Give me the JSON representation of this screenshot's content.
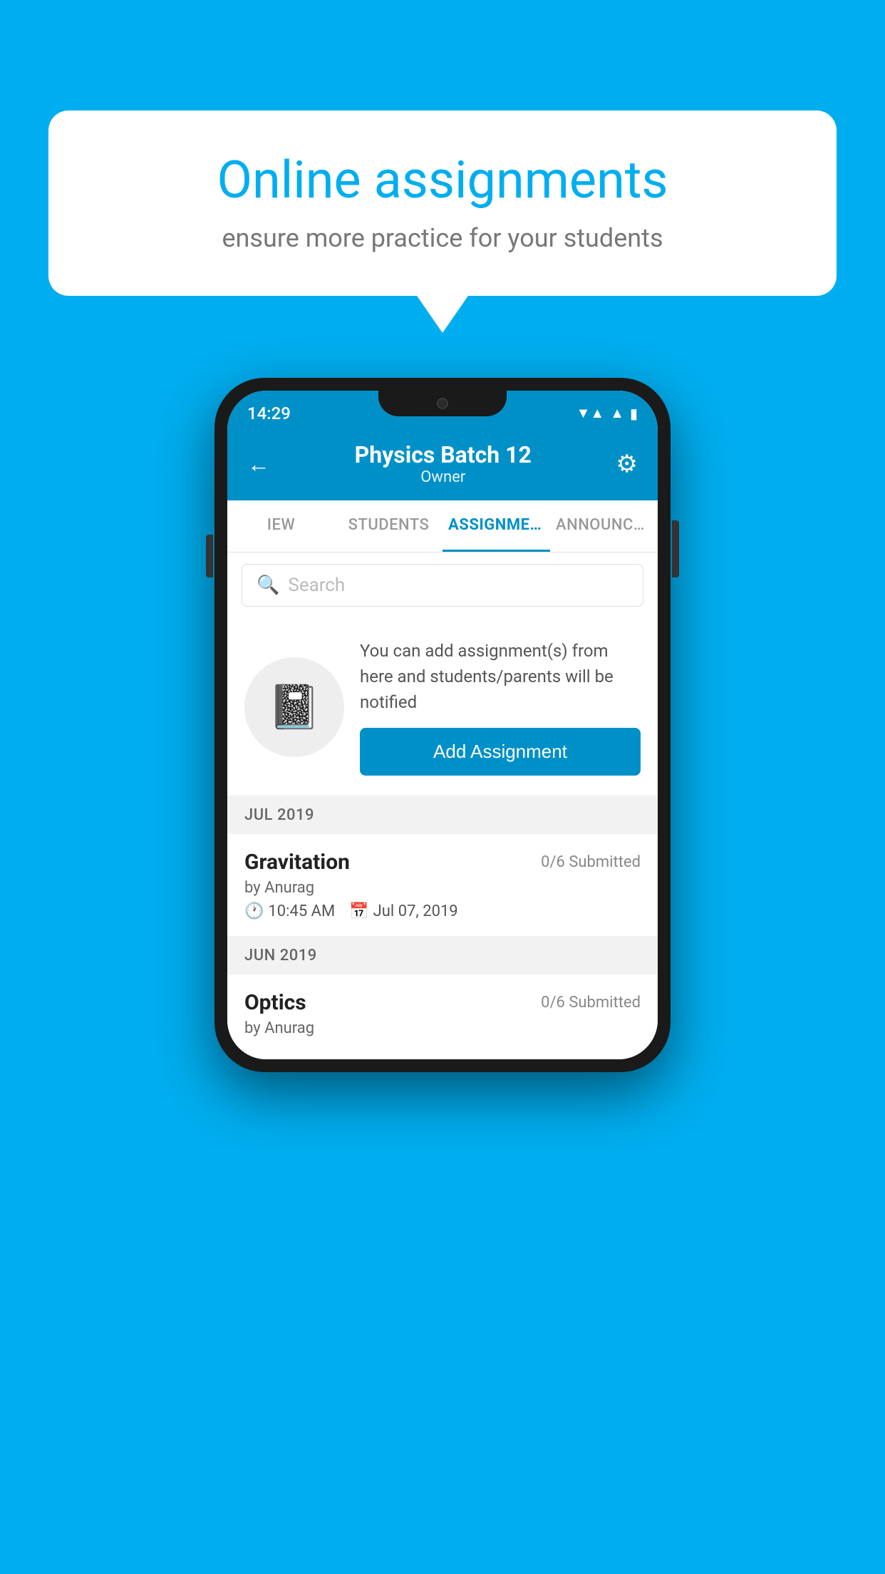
{
  "background": {
    "color": "#00AEEF"
  },
  "speech_bubble": {
    "title": "Online assignments",
    "subtitle": "ensure more practice for your students"
  },
  "phone": {
    "status_bar": {
      "time": "14:29",
      "wifi": "▲",
      "signal": "▲",
      "battery": "▮"
    },
    "header": {
      "title": "Physics Batch 12",
      "subtitle": "Owner",
      "back_label": "←",
      "gear_label": "⚙"
    },
    "tabs": [
      {
        "label": "IEW",
        "active": false
      },
      {
        "label": "STUDENTS",
        "active": false
      },
      {
        "label": "ASSIGNMENTS",
        "active": true
      },
      {
        "label": "ANNOUNCEM",
        "active": false
      }
    ],
    "search": {
      "placeholder": "Search"
    },
    "promo": {
      "text": "You can add assignment(s) from here and students/parents will be notified",
      "button_label": "Add Assignment"
    },
    "sections": [
      {
        "month": "JUL 2019",
        "assignments": [
          {
            "name": "Gravitation",
            "submitted": "0/6 Submitted",
            "author": "by Anurag",
            "time": "10:45 AM",
            "date": "Jul 07, 2019"
          }
        ]
      },
      {
        "month": "JUN 2019",
        "assignments": [
          {
            "name": "Optics",
            "submitted": "0/6 Submitted",
            "author": "by Anurag",
            "time": "",
            "date": ""
          }
        ]
      }
    ]
  }
}
